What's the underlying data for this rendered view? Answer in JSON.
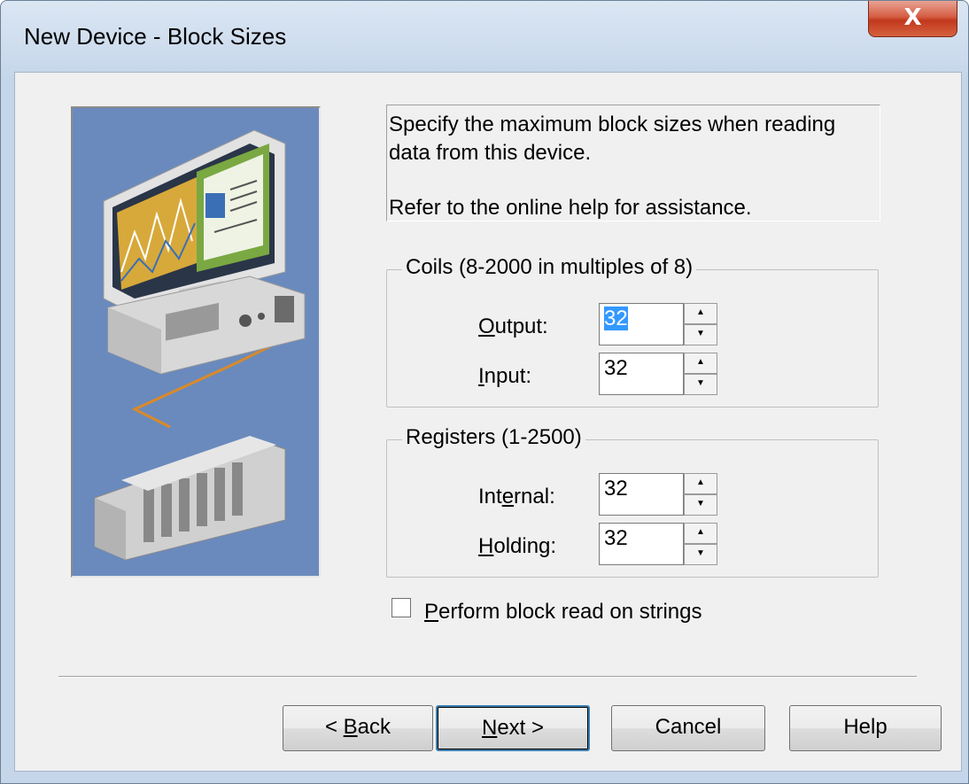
{
  "window": {
    "title": "New Device - Block Sizes",
    "close_glyph": "X"
  },
  "description": {
    "line1": "Specify the maximum block sizes when reading",
    "line2": "data from this device.",
    "line3": "Refer to the online help for assistance."
  },
  "coils": {
    "title": "Coils (8-2000 in multiples of 8)",
    "output": {
      "label_mnemonic": "O",
      "label_rest": "utput:",
      "value": "32"
    },
    "input": {
      "label_mnemonic": "I",
      "label_rest": "nput:",
      "value": "32"
    }
  },
  "registers": {
    "title": "Registers (1-2500)",
    "internal": {
      "label_pre": "Int",
      "label_mnemonic": "e",
      "label_rest": "rnal:",
      "value": "32"
    },
    "holding": {
      "label_mnemonic": "H",
      "label_rest": "olding:",
      "value": "32"
    }
  },
  "strings_option": {
    "label_mnemonic": "P",
    "label_rest": "erform block read on strings",
    "checked": false
  },
  "buttons": {
    "back": {
      "pre": "< ",
      "mnemonic": "B",
      "rest": "ack"
    },
    "next": {
      "mnemonic": "N",
      "rest": "ext >"
    },
    "cancel": "Cancel",
    "help": "Help"
  },
  "icons": {
    "spin_up": "▲",
    "spin_down": "▼"
  },
  "colors": {
    "illustration_bg": "#6a8abd",
    "selection": "#3399ff",
    "close_button": "#c2381c"
  }
}
